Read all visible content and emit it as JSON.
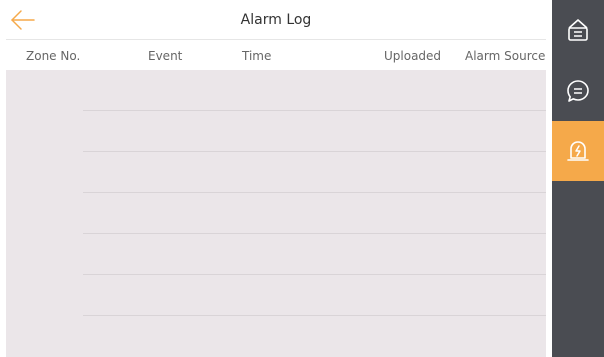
{
  "header": {
    "title": "Alarm Log",
    "back_icon": "arrow-left-icon",
    "accent_color": "#f5a94a"
  },
  "table": {
    "columns": [
      {
        "label": "Zone No."
      },
      {
        "label": "Event"
      },
      {
        "label": "Time"
      },
      {
        "label": "Uploaded"
      },
      {
        "label": "Alarm Source"
      }
    ],
    "rows": []
  },
  "sidebar": {
    "items": [
      {
        "icon": "notice-icon",
        "active": false
      },
      {
        "icon": "message-icon",
        "active": false
      },
      {
        "icon": "alarm-log-icon",
        "active": true
      }
    ],
    "background_color": "#4a4c52",
    "active_color": "#f5a94a"
  },
  "colors": {
    "list_background": "#ebe6e9",
    "divider": "#d9d4d7"
  }
}
